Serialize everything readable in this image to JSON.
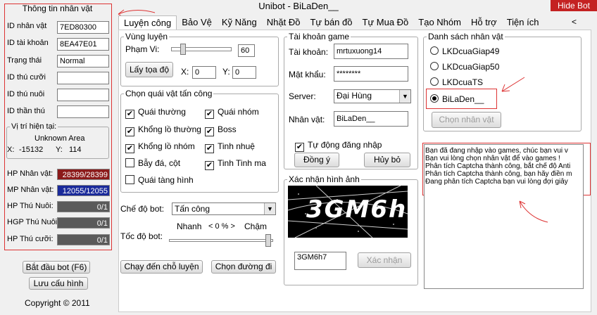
{
  "window": {
    "title": "Unibot - BiLaDen__",
    "hide_button": "Hide Bot"
  },
  "tabs": [
    "Luyện công",
    "Bảo Vệ",
    "Kỹ Năng",
    "Nhặt Đồ",
    "Tự bán đồ",
    "Tự Mua Đồ",
    "Tạo Nhóm",
    "Hỗ trợ",
    "Tiện ích"
  ],
  "tab_arrows": "< >",
  "char_info": {
    "header": "Thông tin nhân vật",
    "id_label": "ID nhân vật",
    "id_value": "7ED80300",
    "account_label": "ID tài khoản",
    "account_value": "8EA47E01",
    "status_label": "Trạng thái",
    "status_value": "Normal",
    "mount_label": "ID thú cưỡi",
    "mount_value": "",
    "pet_label": "ID thú nuôi",
    "pet_value": "",
    "spirit_label": "ID thần thú",
    "spirit_value": ""
  },
  "position": {
    "legend": "Vị trí hiện tại:",
    "area": "Unknown Area",
    "x_label": "X:",
    "x_value": "-15132",
    "y_label": "Y:",
    "y_value": "114"
  },
  "stats": [
    {
      "label": "HP Nhân vật:",
      "value": "28399/28399",
      "color": "#8b1a1a"
    },
    {
      "label": "MP Nhân vật:",
      "value": "12055/12055",
      "color": "#1a2a9a"
    },
    {
      "label": "HP Thú Nuôi:",
      "value": "0/1",
      "color": "#5a5a5a"
    },
    {
      "label": "HGP Thú Nuôi:",
      "value": "0/1",
      "color": "#5a5a5a"
    },
    {
      "label": "HP Thú cưỡi:",
      "value": "0/1",
      "color": "#5a5a5a"
    }
  ],
  "buttons": {
    "start_bot": "Bắt đầu bot (F6)",
    "save_image": "Lưu cấu hình"
  },
  "copyright": "Copyright © 2011",
  "training_area": {
    "legend": "Vùng luyện",
    "range_label": "Phạm Vi:",
    "range_value": "60",
    "get_coords": "Lấy tọa độ",
    "x_label": "X:",
    "x_value": "0",
    "y_label": "Y:",
    "y_value": "0"
  },
  "monsters": {
    "legend": "Chọn quái vật tấn công",
    "items": [
      {
        "label": "Quái thường",
        "checked": true
      },
      {
        "label": "Quái nhóm",
        "checked": true
      },
      {
        "label": "Khổng lồ thường",
        "checked": true
      },
      {
        "label": "Boss",
        "checked": true
      },
      {
        "label": "Khổng lồ nhóm",
        "checked": true
      },
      {
        "label": "Tinh nhuệ",
        "checked": true
      },
      {
        "label": "Bẫy đá, cột",
        "checked": false
      },
      {
        "label": "Tinh Tinh ma",
        "checked": true
      },
      {
        "label": "Quái tàng hình",
        "checked": false
      }
    ]
  },
  "bot_mode": {
    "label": "Chế độ bot:",
    "value": "Tấn công"
  },
  "bot_speed": {
    "label": "Tốc độ bot:",
    "fast": "Nhanh",
    "percent": "< 0 % >",
    "slow": "Chậm"
  },
  "actions": {
    "run_to_spot": "Chạy đến chỗ luyện",
    "pick_path": "Chọn đường đi"
  },
  "account": {
    "legend": "Tài khoản game",
    "user_label": "Tài khoản:",
    "user_value": "mrtuxuong14",
    "pass_label": "Mật khẩu:",
    "pass_value": "********",
    "server_label": "Server:",
    "server_value": "Đại Hùng",
    "char_label": "Nhân vật:",
    "char_value": "BiLaDen__",
    "auto_login": "Tự động đăng nhập",
    "agree": "Đồng ý",
    "cancel": "Hủy bỏ"
  },
  "captcha": {
    "legend": "Xác nhận hình ảnh",
    "image_text": "3GM6h7",
    "input_value": "3GM6h7",
    "confirm": "Xác nhận"
  },
  "char_list": {
    "legend": "Danh sách nhân vật",
    "items": [
      {
        "label": "LKDcuaGiap49",
        "selected": false
      },
      {
        "label": "LKDcuaGiap50",
        "selected": false
      },
      {
        "label": "LKDcuaTS",
        "selected": false
      },
      {
        "label": "BiLaDen__",
        "selected": true
      }
    ],
    "select_button": "Chọn nhân vật"
  },
  "log": [
    "Bạn đã đang nhập vào games, chúc bạn vui v",
    "Bạn vui lòng chọn nhân vật để vào games !",
    "Phân tích Captcha thành công, bắt chế độ Anti",
    "Phân tích Captcha thành công, bạn hãy điền m",
    "Đang phân tích Captcha bạn vui lòng đợi giây"
  ]
}
